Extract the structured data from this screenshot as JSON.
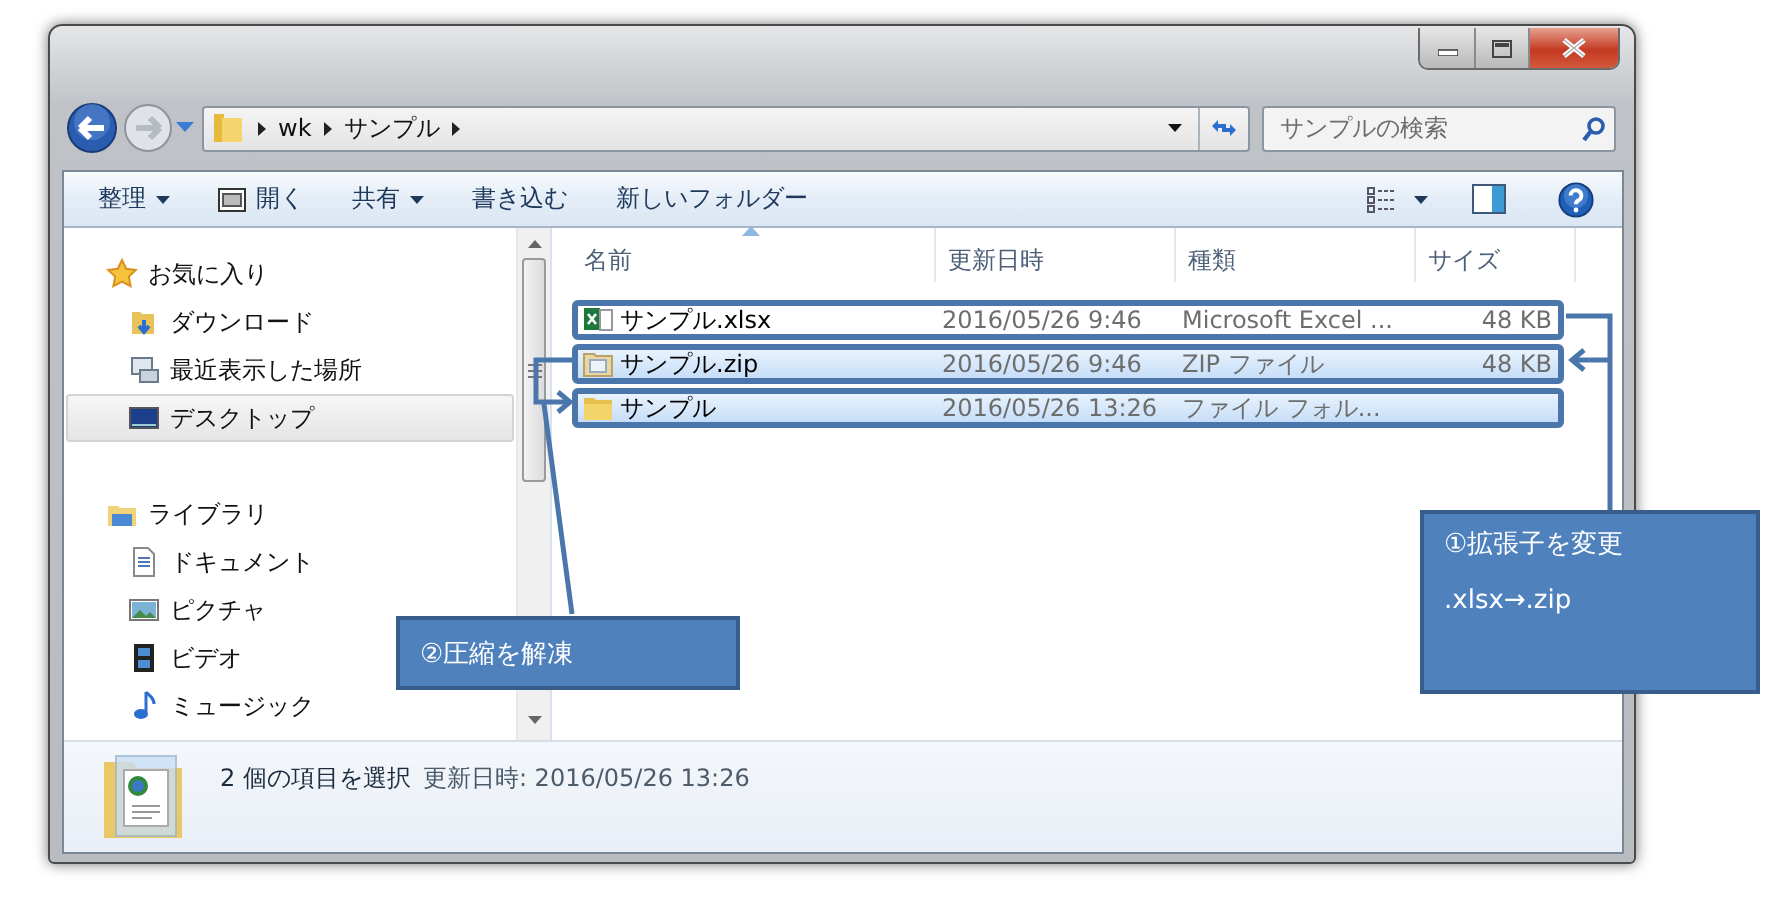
{
  "address": {
    "crumbs": [
      "wk",
      "サンプル"
    ]
  },
  "search": {
    "placeholder": "サンプルの検索"
  },
  "toolbar": {
    "buttons": [
      {
        "label": "整理",
        "kind": "menu"
      },
      {
        "label": "開く",
        "kind": "open"
      },
      {
        "label": "共有",
        "kind": "menu"
      },
      {
        "label": "書き込む",
        "kind": "plain"
      },
      {
        "label": "新しいフォルダー",
        "kind": "plain"
      }
    ]
  },
  "nav": {
    "groups": [
      {
        "label": "お気に入り",
        "kind": "favorites",
        "selected": false,
        "children": [
          {
            "label": "ダウンロード",
            "kind": "download",
            "selected": false
          },
          {
            "label": "最近表示した場所",
            "kind": "recent",
            "selected": false
          },
          {
            "label": "デスクトップ",
            "kind": "desktop",
            "selected": true
          }
        ]
      },
      {
        "label": "ライブラリ",
        "kind": "library",
        "selected": false,
        "children": [
          {
            "label": "ドキュメント",
            "kind": "document",
            "selected": false
          },
          {
            "label": "ピクチャ",
            "kind": "picture",
            "selected": false
          },
          {
            "label": "ビデオ",
            "kind": "video",
            "selected": false
          },
          {
            "label": "ミュージック",
            "kind": "music",
            "selected": false
          }
        ]
      }
    ]
  },
  "files": {
    "columns": [
      {
        "label": "名前",
        "sorted": true
      },
      {
        "label": "更新日時",
        "sorted": false
      },
      {
        "label": "種類",
        "sorted": false
      },
      {
        "label": "サイズ",
        "sorted": false
      }
    ],
    "rows": [
      {
        "kind": "excel",
        "name": "サンプル.xlsx",
        "date": "2016/05/26 9:46",
        "type": "Microsoft Excel ...",
        "size": "48 KB",
        "selected": false,
        "outlined": true
      },
      {
        "kind": "zip",
        "name": "サンプル.zip",
        "date": "2016/05/26 9:46",
        "type": "ZIP ファイル",
        "size": "48 KB",
        "selected": true,
        "outlined": true
      },
      {
        "kind": "folder",
        "name": "サンプル",
        "date": "2016/05/26 13:26",
        "type": "ファイル フォル...",
        "size": "",
        "selected": true,
        "outlined": true
      }
    ]
  },
  "status": {
    "selection": "2 個の項目を選択",
    "detail": "更新日時: 2016/05/26 13:26"
  },
  "annotations": {
    "callouts": [
      {
        "lines": [
          "①拡張子を変更",
          ".xlsx→.zip"
        ]
      },
      {
        "lines": [
          "②圧縮を解凍"
        ]
      }
    ]
  }
}
